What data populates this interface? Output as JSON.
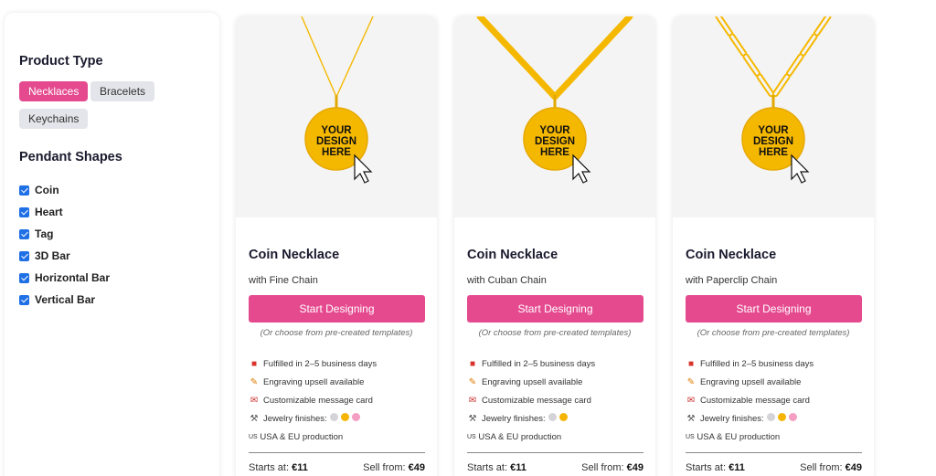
{
  "sidebar": {
    "product_type_title": "Product Type",
    "product_types": [
      {
        "label": "Necklaces",
        "active": true
      },
      {
        "label": "Bracelets",
        "active": false
      },
      {
        "label": "Keychains",
        "active": false
      }
    ],
    "pendant_shapes_title": "Pendant Shapes",
    "pendant_shapes": [
      {
        "label": "Coin",
        "checked": true
      },
      {
        "label": "Heart",
        "checked": true
      },
      {
        "label": "Tag",
        "checked": true
      },
      {
        "label": "3D Bar",
        "checked": true
      },
      {
        "label": "Horizontal Bar",
        "checked": true
      },
      {
        "label": "Vertical Bar",
        "checked": true
      }
    ]
  },
  "pendant_text": [
    "YOUR",
    "DESIGN",
    "HERE"
  ],
  "products": [
    {
      "title": "Coin Necklace",
      "subtitle": "with Fine Chain",
      "chain_style": "fine",
      "cta": "Start Designing",
      "note": "(Or choose from pre-created templates)",
      "features": {
        "fulfilled": "Fulfilled in 2–5 business days",
        "engraving": "Engraving upsell available",
        "card": "Customizable message card",
        "finishes": "Jewelry finishes:",
        "production_us": "US",
        "production_eu": "EU",
        "production": "USA & EU production"
      },
      "finish_colors": [
        "#d4d4d8",
        "#f5b400",
        "#f59ec4"
      ],
      "starts_at_label": "Starts at:",
      "starts_at_value": "€11",
      "sell_from_label": "Sell from:",
      "sell_from_value": "€49"
    },
    {
      "title": "Coin Necklace",
      "subtitle": "with Cuban Chain",
      "chain_style": "cuban",
      "cta": "Start Designing",
      "note": "(Or choose from pre-created templates)",
      "features": {
        "fulfilled": "Fulfilled in 2–5 business days",
        "engraving": "Engraving upsell available",
        "card": "Customizable message card",
        "finishes": "Jewelry finishes:",
        "production_us": "US",
        "production_eu": "EU",
        "production": "USA & EU production"
      },
      "finish_colors": [
        "#d4d4d8",
        "#f5b400"
      ],
      "starts_at_label": "Starts at:",
      "starts_at_value": "€11",
      "sell_from_label": "Sell from:",
      "sell_from_value": "€49"
    },
    {
      "title": "Coin Necklace",
      "subtitle": "with Paperclip Chain",
      "chain_style": "paperclip",
      "cta": "Start Designing",
      "note": "(Or choose from pre-created templates)",
      "features": {
        "fulfilled": "Fulfilled in 2–5 business days",
        "engraving": "Engraving upsell available",
        "card": "Customizable message card",
        "finishes": "Jewelry finishes:",
        "production_us": "US",
        "production_eu": "EU",
        "production": "USA & EU production"
      },
      "finish_colors": [
        "#d4d4d8",
        "#f5b400",
        "#f59ec4"
      ],
      "starts_at_label": "Starts at:",
      "starts_at_value": "€11",
      "sell_from_label": "Sell from:",
      "sell_from_value": "€49"
    }
  ],
  "colors": {
    "accent": "#e54a8f",
    "checkbox": "#1f6fe5",
    "gold": "#f5b800",
    "image_bg": "#f4f4f5"
  }
}
